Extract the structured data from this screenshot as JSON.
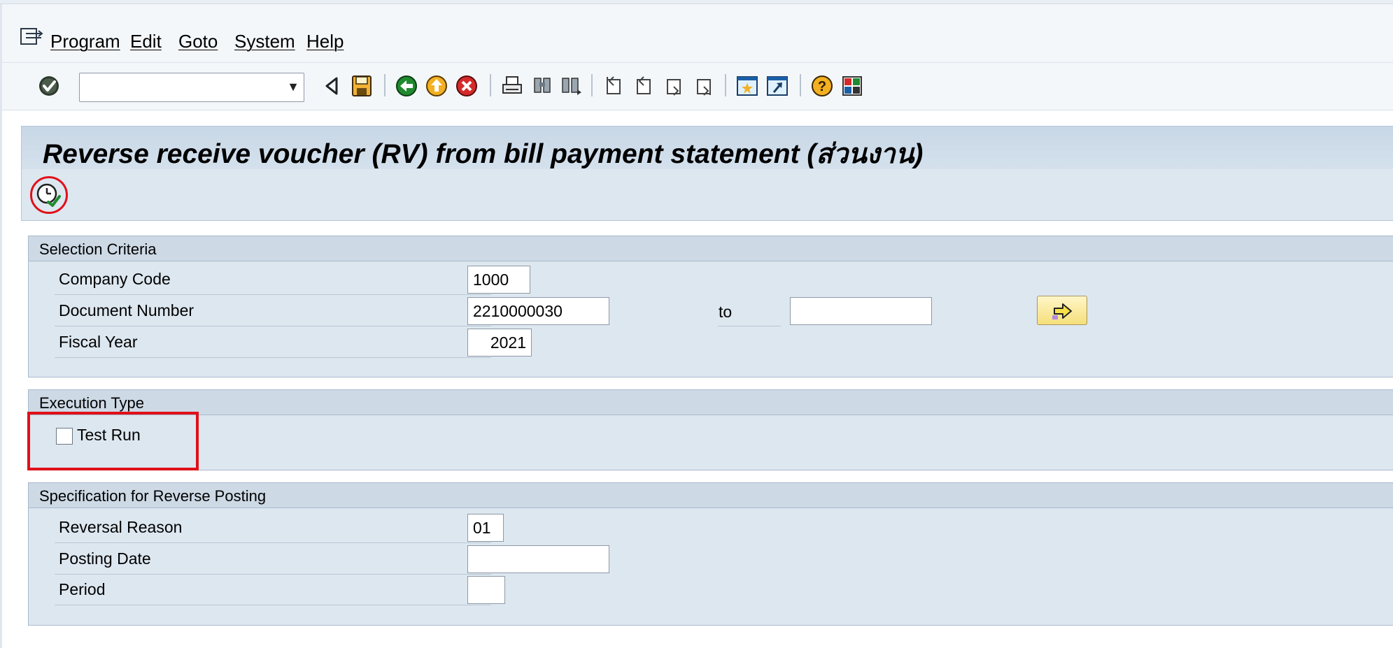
{
  "menu": {
    "items": [
      "Program",
      "Edit",
      "Goto",
      "System",
      "Help"
    ]
  },
  "toolbar": {
    "command_field_value": "",
    "icons": [
      "enter-icon",
      "back-icon",
      "save-icon",
      "green-back-icon",
      "exit-icon",
      "cancel-icon",
      "print-icon",
      "find-icon",
      "find-next-icon",
      "first-page-icon",
      "previous-page-icon",
      "next-page-icon",
      "last-page-icon",
      "create-session-icon",
      "shortcut-icon",
      "help-icon",
      "customize-layout-icon"
    ]
  },
  "page": {
    "title": "Reverse receive voucher (RV) from bill payment statement (ส่วนงาน)"
  },
  "app_toolbar": {
    "execute_icon": "execute-icon"
  },
  "selection_criteria": {
    "title": "Selection Criteria",
    "company_code_label": "Company Code",
    "company_code_value": "1000",
    "document_number_label": "Document Number",
    "document_number_value": "2210000030",
    "to_label": "to",
    "document_number_to_value": "",
    "fiscal_year_label": "Fiscal Year",
    "fiscal_year_value": "2021",
    "multiple_selection_icon": "multiple-selection-arrow-icon"
  },
  "execution_type": {
    "title": "Execution Type",
    "test_run_label": "Test Run",
    "test_run_checked": false
  },
  "reverse_posting": {
    "title": "Specification for Reverse Posting",
    "reversal_reason_label": "Reversal Reason",
    "reversal_reason_value": "01",
    "posting_date_label": "Posting Date",
    "posting_date_value": "",
    "period_label": "Period",
    "period_value": ""
  },
  "colors": {
    "highlight_red": "#e0101a",
    "group_background": "#dde7f0",
    "title_background": "#c8d7e6"
  }
}
